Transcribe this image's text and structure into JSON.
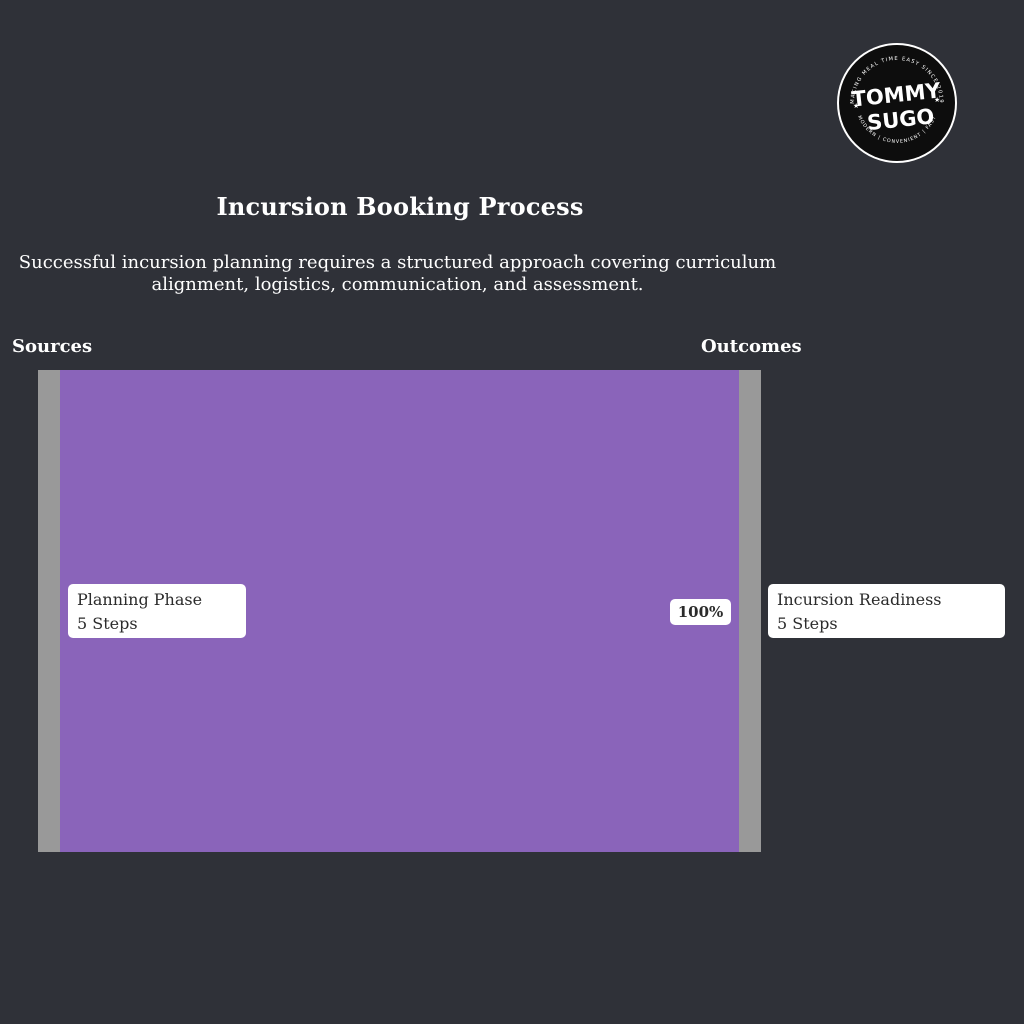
{
  "header": {
    "title": "Incursion Booking Process",
    "subtitle": "Successful incursion planning requires a structured approach covering curriculum alignment, logistics, communication, and assessment."
  },
  "columns": {
    "sources": "Sources",
    "outcomes": "Outcomes"
  },
  "nodes": {
    "source": {
      "name": "Planning Phase",
      "value": "5 Steps"
    },
    "target": {
      "name": "Incursion Readiness",
      "value": "5 Steps"
    }
  },
  "flow": {
    "percent_label": "100%",
    "share": 1.0
  },
  "logo": {
    "line1": "TOMMY",
    "line2": "SUGO",
    "arc_top": "MAKING MEAL TIME EASY SINCE 2019",
    "arc_bottom": "MODERN | CONVENIENT | FAST"
  },
  "colors": {
    "background": "#2f3138",
    "flow": "#8a64ba",
    "node": "#999999",
    "label_bg": "#ffffff"
  }
}
